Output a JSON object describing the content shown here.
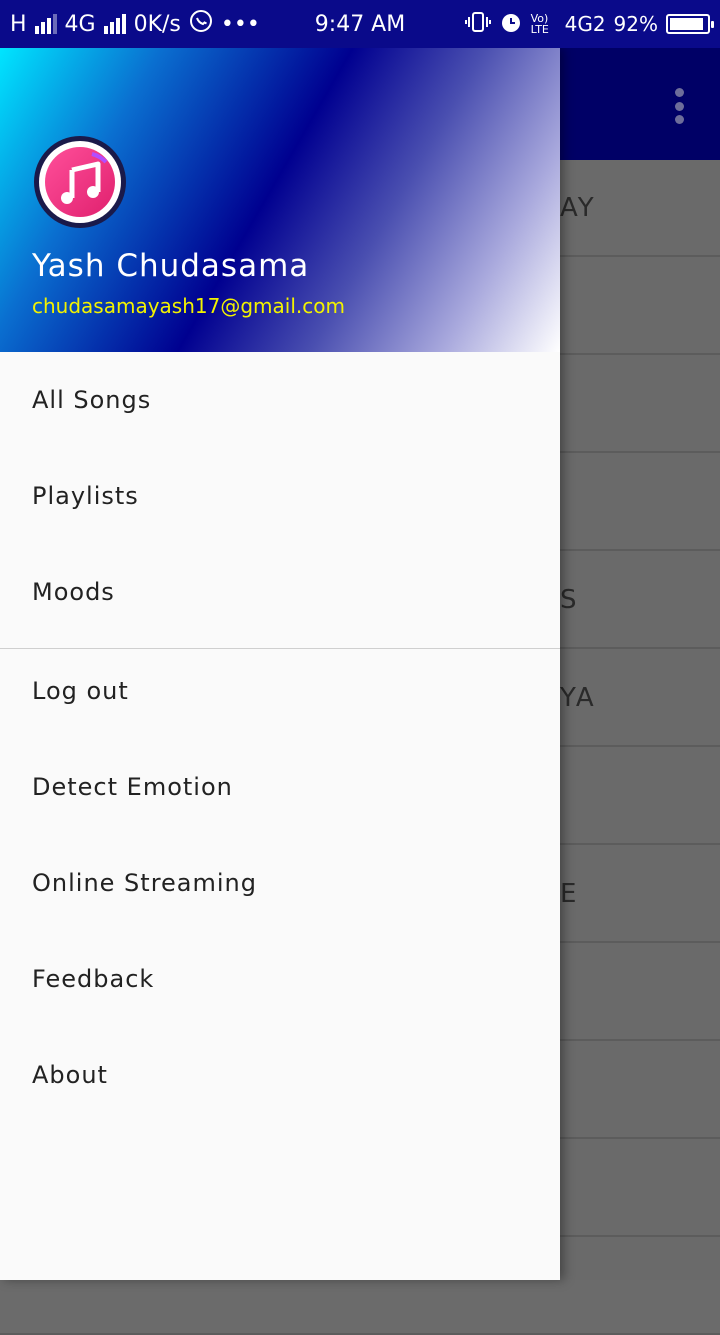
{
  "status_bar": {
    "network_left": "H",
    "network_type": "4G",
    "speed": "0K/s",
    "time": "9:47 AM",
    "volte": "Vo) LTE",
    "network_right": "4G2",
    "battery": "92%",
    "battery_level": 0.92
  },
  "drawer": {
    "user_name": "Yash Chudasama",
    "user_email": "chudasamayash17@gmail.com",
    "primary_items": [
      {
        "label": "All Songs"
      },
      {
        "label": "Playlists"
      },
      {
        "label": "Moods"
      }
    ],
    "secondary_items": [
      {
        "label": "Log out"
      },
      {
        "label": "Detect Emotion"
      },
      {
        "label": "Online Streaming"
      },
      {
        "label": "Feedback"
      },
      {
        "label": "About"
      }
    ]
  },
  "background_list": {
    "rows": [
      "AY",
      "",
      "",
      "",
      "S",
      "YA",
      "",
      "E",
      "",
      "",
      "",
      ""
    ]
  },
  "colors": {
    "status_bar": "#0a0a8a",
    "toolbar": "#000066",
    "email": "#f2f200",
    "drawer_bg": "#fafafa"
  }
}
